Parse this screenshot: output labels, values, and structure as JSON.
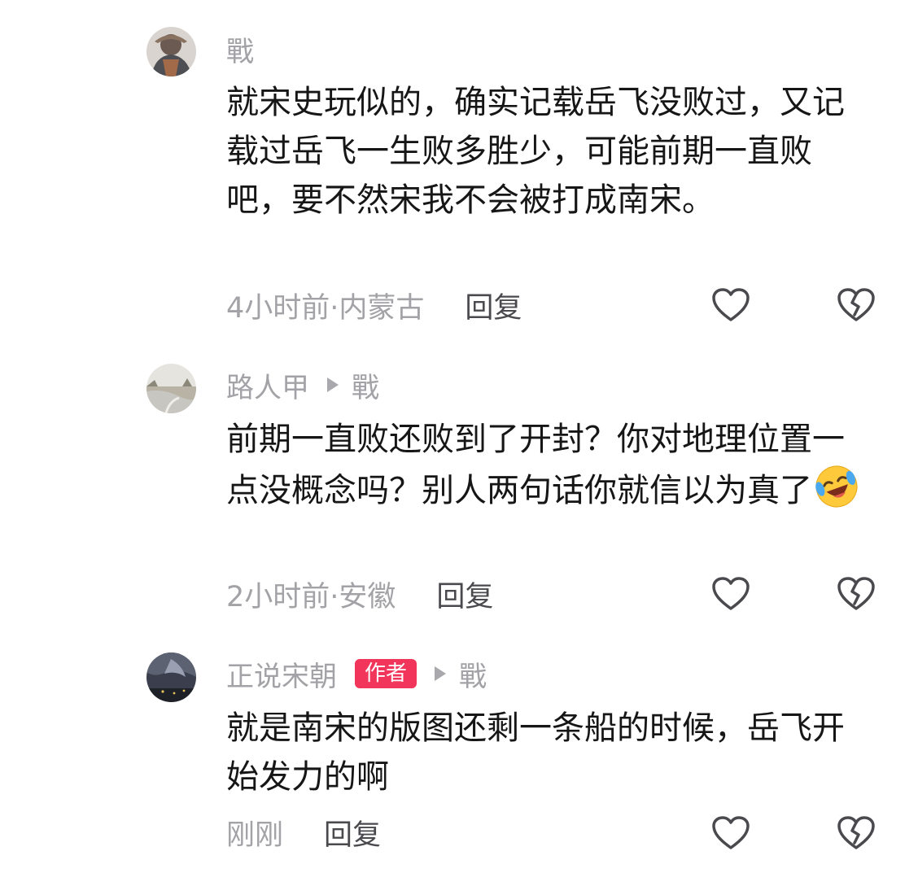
{
  "comments": [
    {
      "author": "戰",
      "text": "就宋史玩似的，确实记载岳飞没败过，又记载过岳飞一生败多胜少，可能前期一直败吧，要不然宋我不会被打成南宋。",
      "time_location": "4小时前·内蒙古",
      "reply_label": "回复",
      "avatar_icon": "avatar-armored-warrior-icon"
    },
    {
      "author": "路人甲",
      "reply_to": "戰",
      "text": "前期一直败还败到了开封？你对地理位置一点没概念吗？别人两句话你就信以为真了",
      "emoji_icon": "laughing-crying-emoji-icon",
      "time_location": "2小时前·安徽",
      "reply_label": "回复",
      "avatar_icon": "avatar-riverside-landscape-icon"
    },
    {
      "author": "正说宋朝",
      "author_badge": "作者",
      "reply_to": "戰",
      "text": "就是南宋的版图还剩一条船的时候，岳飞开始发力的啊",
      "time_location": "刚刚",
      "reply_label": "回复",
      "avatar_icon": "avatar-stormy-sky-icon"
    }
  ],
  "colors": {
    "badge": "#f2355b",
    "meta_text": "#a3a3a7",
    "body_text": "#161616",
    "icon_stroke": "#4a4a4e"
  }
}
